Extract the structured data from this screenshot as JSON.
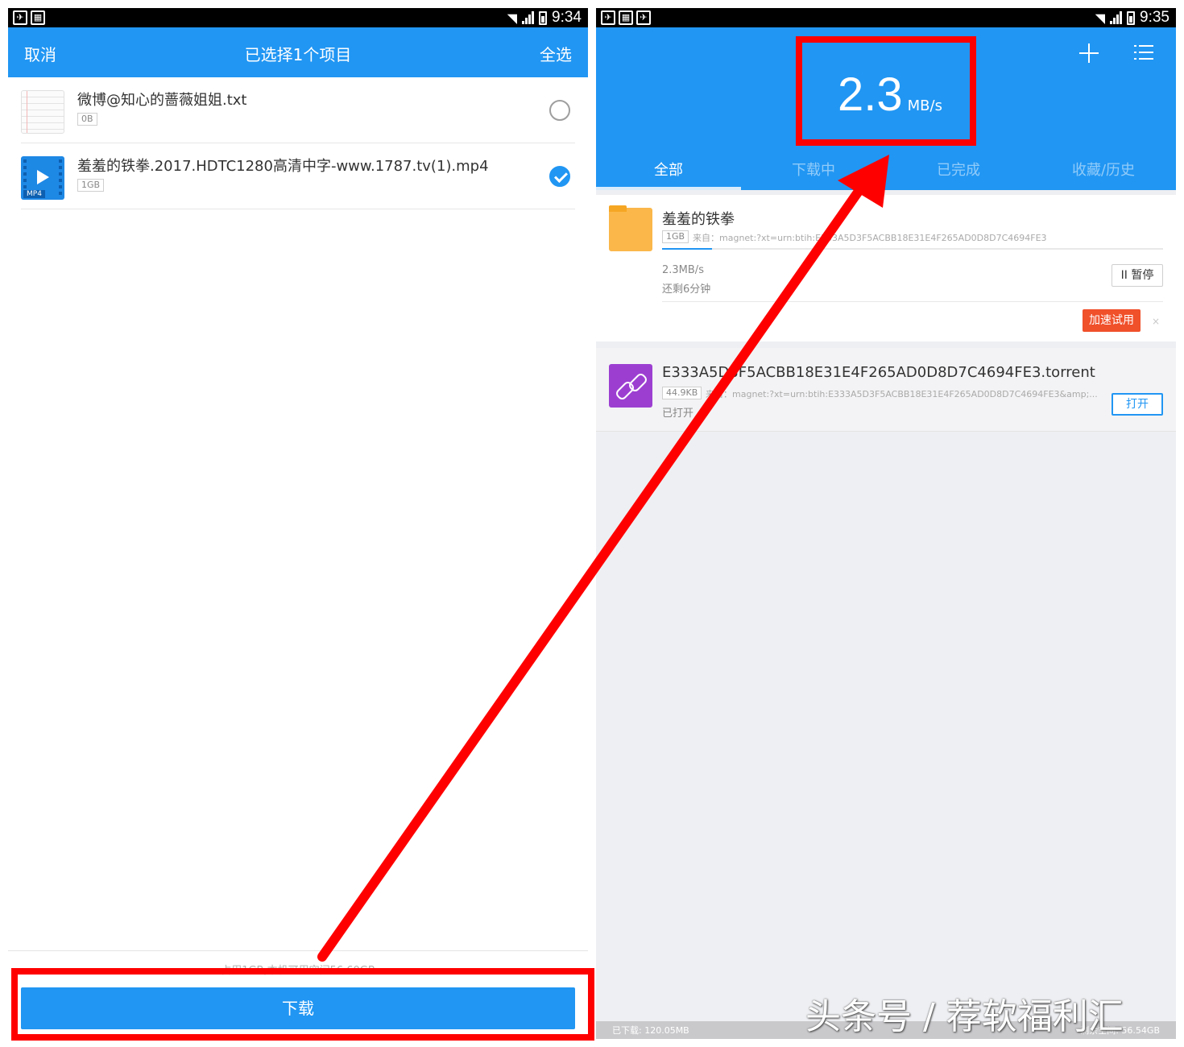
{
  "left_screen": {
    "status": {
      "time": "9:34"
    },
    "header": {
      "cancel": "取消",
      "title": "已选择1个项目",
      "select_all": "全选"
    },
    "files": [
      {
        "name": "微博@知心的蔷薇姐姐.txt",
        "size": "0B",
        "checked": false,
        "icon": "txt-file-icon"
      },
      {
        "name": "羞羞的铁拳.2017.HDTC1280高清中字-www.1787.tv(1).mp4",
        "size": "1GB",
        "checked": true,
        "icon": "mp4-file-icon",
        "icon_tag": "MP4"
      }
    ],
    "storage_text": "占用1GB,本机可用空间56.60GB",
    "download_button": "下载"
  },
  "right_screen": {
    "status": {
      "time": "9:35"
    },
    "speed": {
      "value": "2.3",
      "unit": "MB/s"
    },
    "tabs": [
      "全部",
      "下载中",
      "已完成",
      "收藏/历史"
    ],
    "task": {
      "title": "羞羞的铁拳",
      "size": "1GB",
      "source": "来自：magnet:?xt=urn:btih:E333A5D3F5ACBB18E31E4F265AD0D8D7C4694FE3",
      "progress": 0.1,
      "speed": "2.3MB/s",
      "remaining": "还剩6分钟",
      "pause_label": "II 暂停",
      "boost_label": "加速试用",
      "close_glyph": "×"
    },
    "torrent": {
      "title": "E333A5D3F5ACBB18E31E4F265AD0D8D7C4694FE3.torrent",
      "size": "44.9KB",
      "source": "来自：magnet:?xt=urn:btih:E333A5D3F5ACBB18E31E4F265AD0D8D7C4694FE3&amp;...",
      "status": "已打开",
      "open_label": "打开"
    },
    "footer": {
      "downloaded": "已下载: 120.05MB",
      "free": "剩余空间: 56.54GB"
    }
  },
  "watermark": "头条号 / 荐软福利汇",
  "colors": {
    "primary": "#2196f3",
    "annotation": "#ff0000",
    "boost": "#f0502a",
    "folder": "#fbb74a",
    "link": "#9c3fd1"
  }
}
